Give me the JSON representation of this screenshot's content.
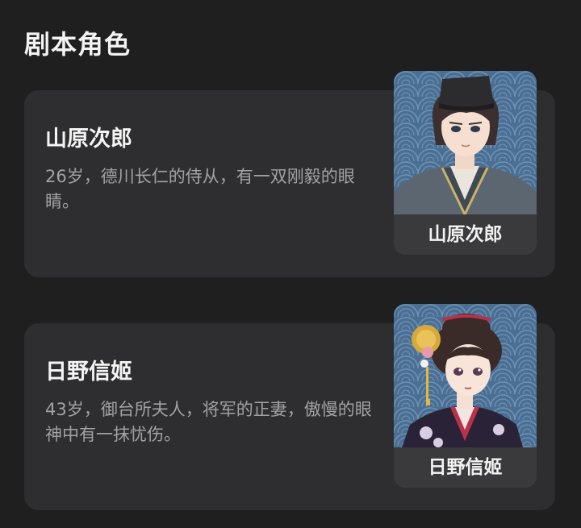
{
  "section": {
    "title": "剧本角色"
  },
  "characters": [
    {
      "name": "山原次郎",
      "description": "26岁，德川长仁的侍从，有一双刚毅的眼睛。",
      "portrait_label": "山原次郎",
      "portrait_icon": "male-samurai-portrait"
    },
    {
      "name": "日野信姬",
      "description": "43岁，御台所夫人，将军的正妻，傲慢的眼神中有一抹忧伤。",
      "portrait_label": "日野信姬",
      "portrait_icon": "female-noble-portrait"
    }
  ],
  "colors": {
    "background": "#1f1f20",
    "card": "#2e2e30",
    "portrait_bg": "#4a6a8c",
    "label_bg": "#3a3a3c"
  }
}
